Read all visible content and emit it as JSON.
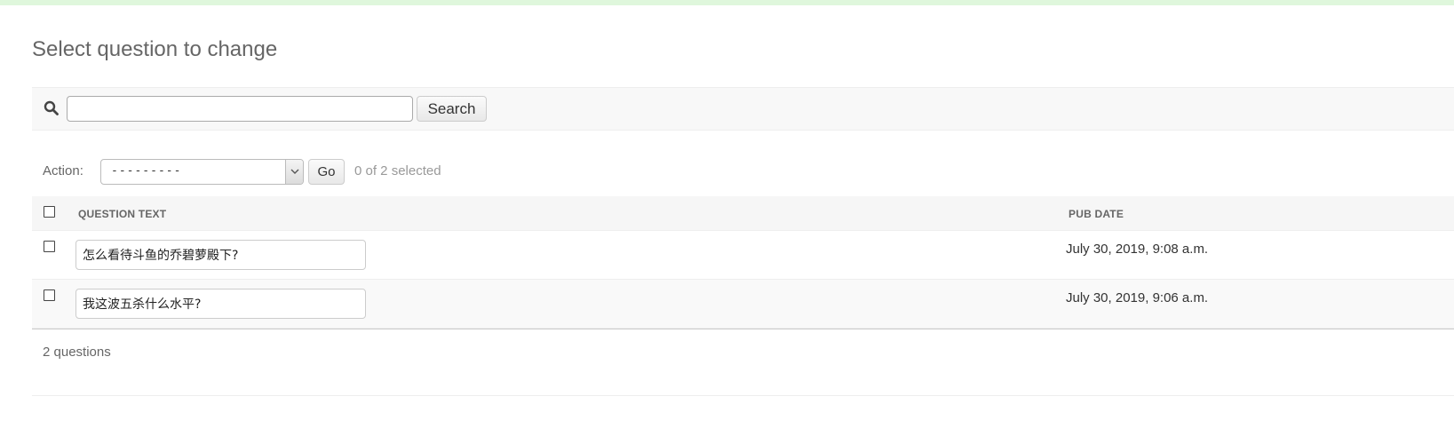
{
  "page": {
    "title": "Select question to change"
  },
  "search": {
    "icon": "search-icon",
    "input_value": "",
    "button_label": "Search"
  },
  "actions": {
    "label": "Action:",
    "selected_option": "---------",
    "go_label": "Go",
    "selection_counter": "0 of 2 selected"
  },
  "table": {
    "columns": [
      "QUESTION TEXT",
      "PUB DATE"
    ],
    "rows": [
      {
        "question_text": "怎么看待斗鱼的乔碧萝殿下?",
        "pub_date": "July 30, 2019, 9:08 a.m."
      },
      {
        "question_text": "我这波五杀什么水平?",
        "pub_date": "July 30, 2019, 9:06 a.m."
      }
    ]
  },
  "footer": {
    "result_count": "2 questions"
  },
  "colors": {
    "banner": "#dff7dc",
    "title": "#666666",
    "header_bg": "#f6f6f6"
  }
}
